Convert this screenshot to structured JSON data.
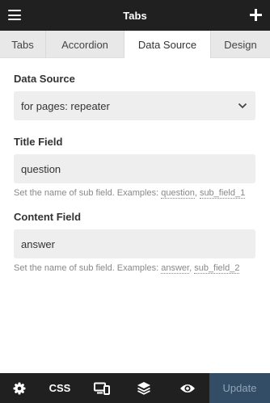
{
  "header": {
    "title": "Tabs",
    "menu_icon": "hamburger-icon",
    "add_icon": "plus-icon"
  },
  "tabs": [
    {
      "label": "Tabs",
      "active": false
    },
    {
      "label": "Accordion",
      "active": false
    },
    {
      "label": "Data Source",
      "active": true
    },
    {
      "label": "Design",
      "active": false
    }
  ],
  "form": {
    "data_source": {
      "label": "Data Source",
      "value": "for pages: repeater"
    },
    "title_field": {
      "label": "Title Field",
      "value": "question",
      "help_prefix": "Set the name of sub field. Examples:",
      "example_1": "question",
      "example_sep": ",",
      "example_2": "sub_field_1"
    },
    "content_field": {
      "label": "Content Field",
      "value": "answer",
      "help_prefix": "Set the name of sub field. Examples:",
      "example_1": "answer",
      "example_sep": ",",
      "example_2": "sub_field_2"
    }
  },
  "toolbar": {
    "settings_icon": "gear-icon",
    "css_label": "CSS",
    "responsive_icon": "responsive-devices-icon",
    "layers_icon": "layers-icon",
    "preview_icon": "eye-icon",
    "update_label": "Update"
  },
  "colors": {
    "bar_bg": "#202020",
    "tab_bg": "#e8e8e8",
    "input_bg": "#eeeeee",
    "update_bg": "#334d66",
    "update_text": "#90a4b8"
  }
}
